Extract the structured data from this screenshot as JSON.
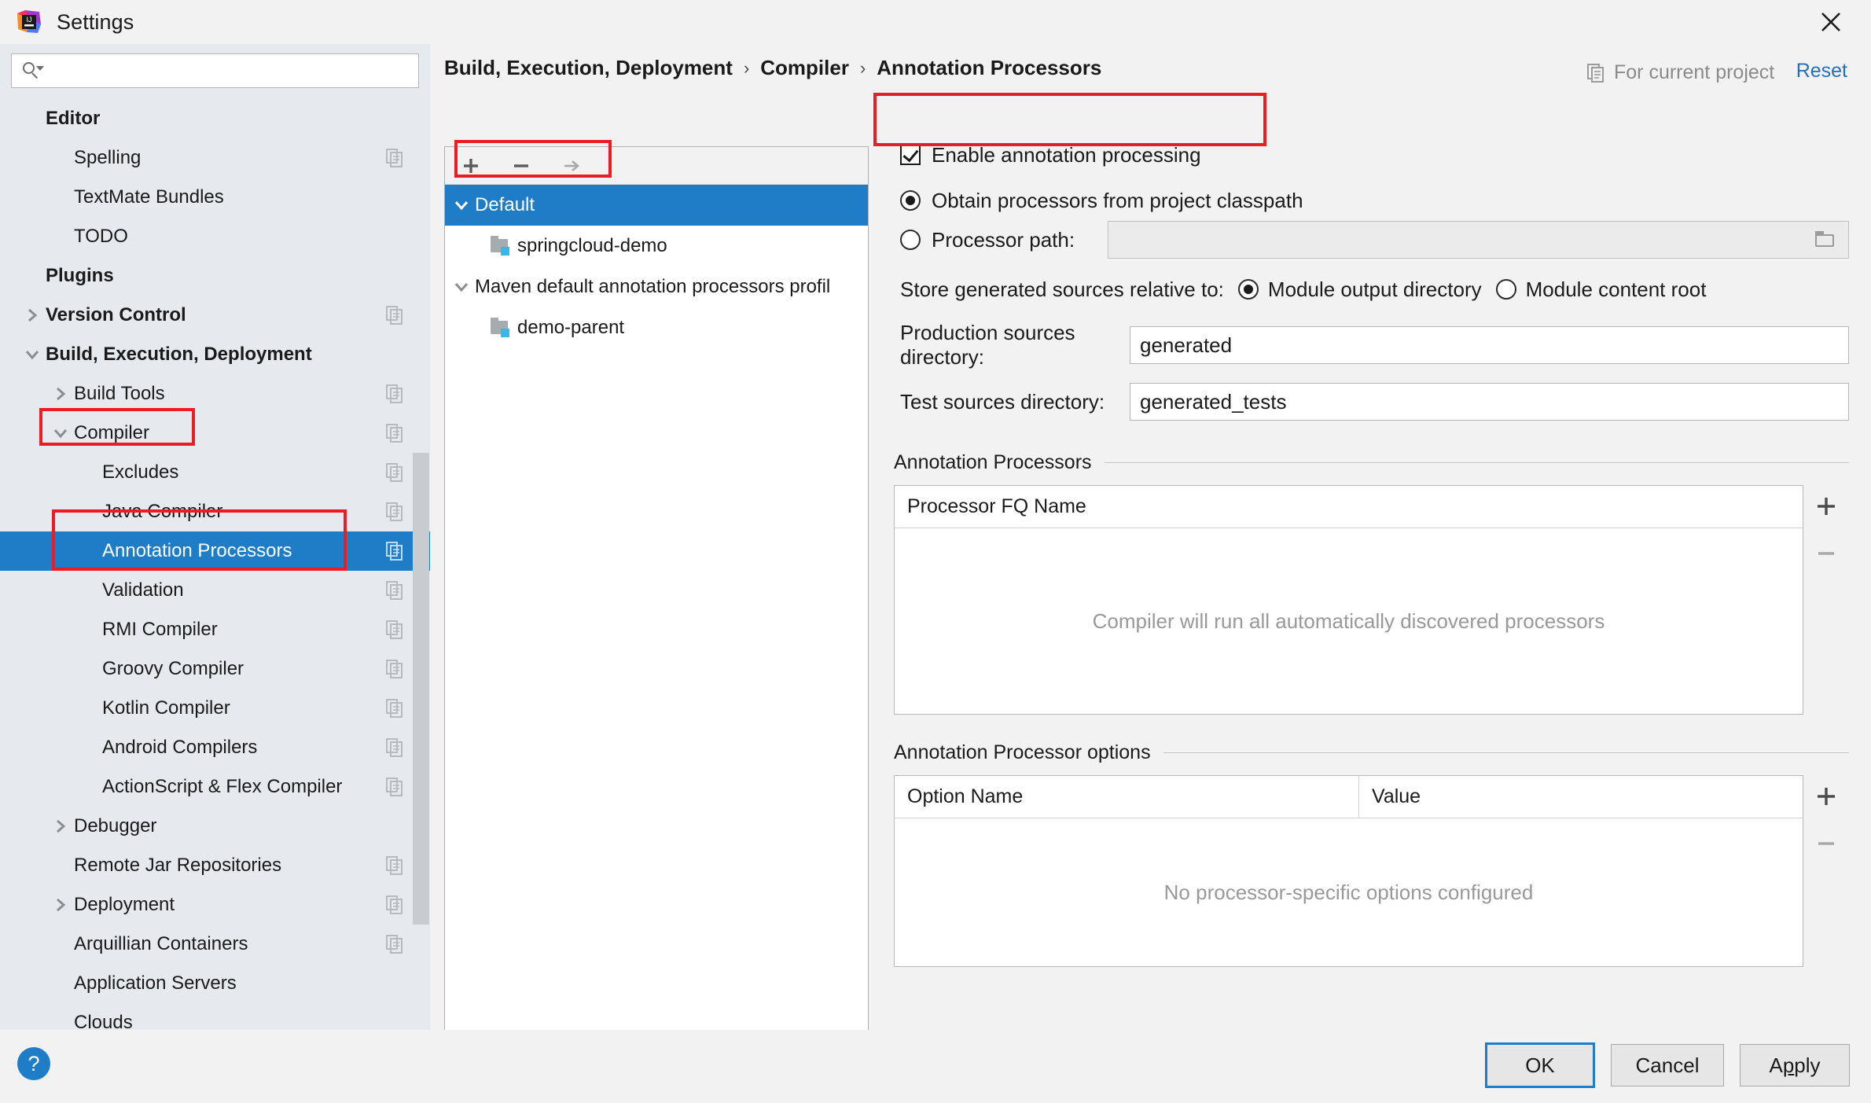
{
  "window": {
    "title": "Settings",
    "app_icon": "intellij-idea-logo",
    "close_icon": "close-icon"
  },
  "search": {
    "placeholder": "",
    "value": "",
    "icon": "search-icon"
  },
  "sidebar": {
    "items": [
      {
        "label": "Editor",
        "level": 0,
        "bold": true,
        "arrow": "none",
        "copy": false,
        "selected": false
      },
      {
        "label": "Spelling",
        "level": 1,
        "bold": false,
        "arrow": "none",
        "copy": true,
        "selected": false
      },
      {
        "label": "TextMate Bundles",
        "level": 1,
        "bold": false,
        "arrow": "none",
        "copy": false,
        "selected": false
      },
      {
        "label": "TODO",
        "level": 1,
        "bold": false,
        "arrow": "none",
        "copy": false,
        "selected": false
      },
      {
        "label": "Plugins",
        "level": 0,
        "bold": true,
        "arrow": "none",
        "copy": false,
        "selected": false
      },
      {
        "label": "Version Control",
        "level": 0,
        "bold": true,
        "arrow": "right",
        "copy": true,
        "selected": false
      },
      {
        "label": "Build, Execution, Deployment",
        "level": 0,
        "bold": true,
        "arrow": "down",
        "copy": false,
        "selected": false
      },
      {
        "label": "Build Tools",
        "level": 1,
        "bold": false,
        "arrow": "right",
        "copy": true,
        "selected": false
      },
      {
        "label": "Compiler",
        "level": 1,
        "bold": false,
        "arrow": "down",
        "copy": true,
        "selected": false
      },
      {
        "label": "Excludes",
        "level": 2,
        "bold": false,
        "arrow": "none",
        "copy": true,
        "selected": false
      },
      {
        "label": "Java Compiler",
        "level": 2,
        "bold": false,
        "arrow": "none",
        "copy": true,
        "selected": false
      },
      {
        "label": "Annotation Processors",
        "level": 2,
        "bold": false,
        "arrow": "none",
        "copy": true,
        "selected": true
      },
      {
        "label": "Validation",
        "level": 2,
        "bold": false,
        "arrow": "none",
        "copy": true,
        "selected": false
      },
      {
        "label": "RMI Compiler",
        "level": 2,
        "bold": false,
        "arrow": "none",
        "copy": true,
        "selected": false
      },
      {
        "label": "Groovy Compiler",
        "level": 2,
        "bold": false,
        "arrow": "none",
        "copy": true,
        "selected": false
      },
      {
        "label": "Kotlin Compiler",
        "level": 2,
        "bold": false,
        "arrow": "none",
        "copy": true,
        "selected": false
      },
      {
        "label": "Android Compilers",
        "level": 2,
        "bold": false,
        "arrow": "none",
        "copy": true,
        "selected": false
      },
      {
        "label": "ActionScript & Flex Compiler",
        "level": 2,
        "bold": false,
        "arrow": "none",
        "copy": true,
        "selected": false
      },
      {
        "label": "Debugger",
        "level": 1,
        "bold": false,
        "arrow": "right",
        "copy": false,
        "selected": false
      },
      {
        "label": "Remote Jar Repositories",
        "level": 1,
        "bold": false,
        "arrow": "none",
        "copy": true,
        "selected": false
      },
      {
        "label": "Deployment",
        "level": 1,
        "bold": false,
        "arrow": "right",
        "copy": true,
        "selected": false
      },
      {
        "label": "Arquillian Containers",
        "level": 1,
        "bold": false,
        "arrow": "none",
        "copy": true,
        "selected": false
      },
      {
        "label": "Application Servers",
        "level": 1,
        "bold": false,
        "arrow": "none",
        "copy": false,
        "selected": false
      },
      {
        "label": "Clouds",
        "level": 1,
        "bold": false,
        "arrow": "none",
        "copy": false,
        "selected": false
      }
    ]
  },
  "header": {
    "breadcrumb": [
      "Build, Execution, Deployment",
      "Compiler",
      "Annotation Processors"
    ],
    "separator": "›",
    "scope_label": "For current project",
    "scope_icon": "copy-icon",
    "reset_label": "Reset"
  },
  "profiles": {
    "toolbar": [
      {
        "name": "add-profile-button",
        "icon": "plus-icon"
      },
      {
        "name": "remove-profile-button",
        "icon": "minus-icon"
      },
      {
        "name": "move-to-profile-button",
        "icon": "arrow-right-icon"
      }
    ],
    "tree": [
      {
        "label": "Default",
        "level": 0,
        "arrow": "down",
        "module": false,
        "selected": true
      },
      {
        "label": "springcloud-demo",
        "level": 1,
        "arrow": "none",
        "module": true,
        "selected": false
      },
      {
        "label": "Maven default annotation processors profil",
        "level": 0,
        "arrow": "down",
        "module": false,
        "selected": false
      },
      {
        "label": "demo-parent",
        "level": 1,
        "arrow": "none",
        "module": true,
        "selected": false
      }
    ]
  },
  "form": {
    "enable_annotation_processing": {
      "label": "Enable annotation processing",
      "checked": true
    },
    "source_mode": {
      "classpath": {
        "label": "Obtain processors from project classpath",
        "selected": true
      },
      "processor_path": {
        "label": "Processor path:",
        "selected": false,
        "value": "",
        "browse_icon": "folder-icon"
      }
    },
    "store_relative": {
      "label": "Store generated sources relative to:",
      "options": [
        {
          "label": "Module output directory",
          "selected": true
        },
        {
          "label": "Module content root",
          "selected": false
        }
      ]
    },
    "production_sources": {
      "label": "Production sources directory:",
      "value": "generated"
    },
    "test_sources": {
      "label": "Test sources directory:",
      "value": "generated_tests"
    }
  },
  "processors_section": {
    "title": "Annotation Processors",
    "column_header": "Processor FQ Name",
    "empty_message": "Compiler will run all automatically discovered processors",
    "rows": [],
    "add_icon": "plus-icon",
    "remove_icon": "minus-icon"
  },
  "options_section": {
    "title": "Annotation Processor options",
    "columns": [
      "Option Name",
      "Value"
    ],
    "empty_message": "No processor-specific options configured",
    "rows": [],
    "add_icon": "plus-icon",
    "remove_icon": "minus-icon"
  },
  "footer": {
    "help_icon": "question-mark-icon",
    "ok_label": "OK",
    "cancel_label": "Cancel",
    "apply_label_pre": "A",
    "apply_label_underline": "p",
    "apply_label_post": "ply"
  },
  "colors": {
    "accent": "#1f7cc6",
    "highlight_box": "#ed1c24",
    "sidebar_bg": "#e6eaee",
    "panel_bg": "#f2f2f2",
    "link": "#2470c0"
  }
}
